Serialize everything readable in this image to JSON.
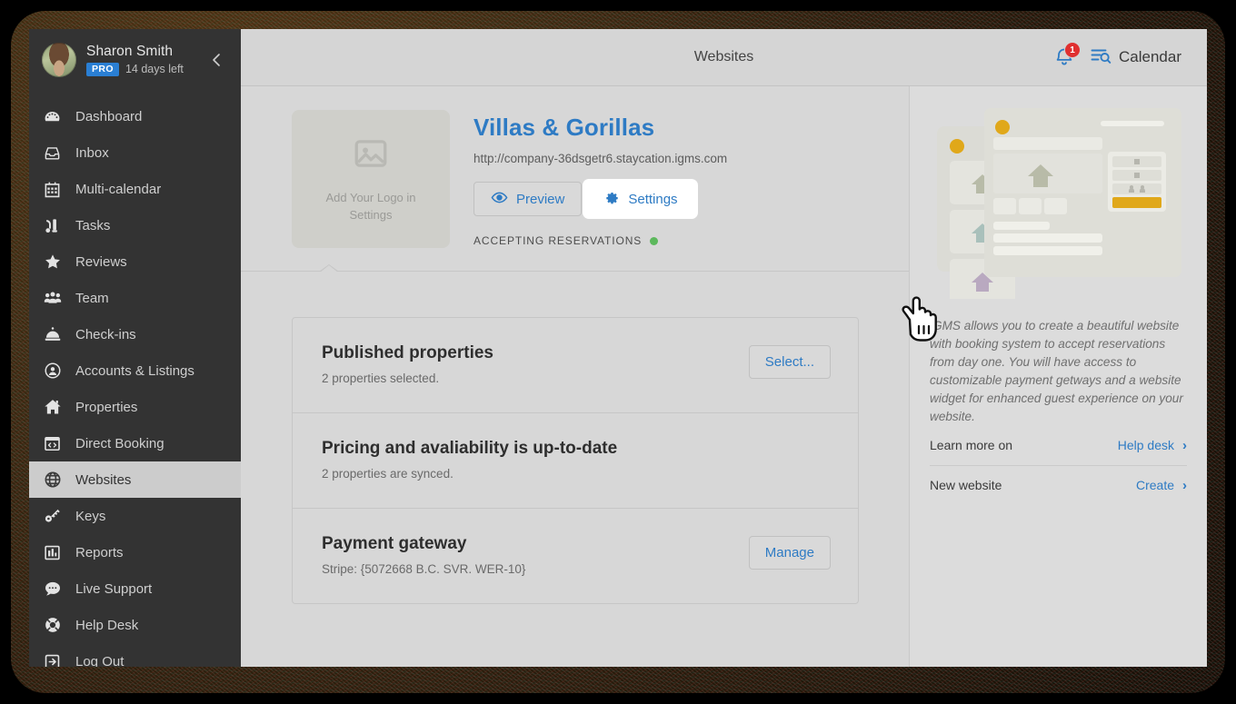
{
  "sidebar": {
    "user": {
      "name": "Sharon Smith",
      "badge": "PRO",
      "trial": "14 days left",
      "avatar_icon": "user-avatar-photo",
      "collapse_icon": "chevron-left-icon"
    },
    "items": [
      {
        "label": "Dashboard",
        "icon": "gauge-icon",
        "active": false
      },
      {
        "label": "Inbox",
        "icon": "inbox-icon",
        "active": false
      },
      {
        "label": "Multi-calendar",
        "icon": "calendar-icon",
        "active": false
      },
      {
        "label": "Tasks",
        "icon": "vacuum-icon",
        "active": false
      },
      {
        "label": "Reviews",
        "icon": "star-icon",
        "active": false
      },
      {
        "label": "Team",
        "icon": "users-icon",
        "active": false
      },
      {
        "label": "Check-ins",
        "icon": "bell-desk-icon",
        "active": false
      },
      {
        "label": "Accounts & Listings",
        "icon": "user-circle-icon",
        "active": false
      },
      {
        "label": "Properties",
        "icon": "home-icon",
        "active": false
      },
      {
        "label": "Direct Booking",
        "icon": "code-window-icon",
        "active": false
      },
      {
        "label": "Websites",
        "icon": "globe-icon",
        "active": true
      },
      {
        "label": "Keys",
        "icon": "key-icon",
        "active": false
      },
      {
        "label": "Reports",
        "icon": "bar-chart-icon",
        "active": false
      },
      {
        "label": "Live Support",
        "icon": "chat-bubble-icon",
        "active": false
      },
      {
        "label": "Help Desk",
        "icon": "lifebuoy-icon",
        "active": false
      },
      {
        "label": "Log Out",
        "icon": "logout-icon",
        "active": false
      }
    ]
  },
  "topbar": {
    "title": "Websites",
    "notifications_count": "1",
    "bell_icon": "notification-bell-icon",
    "calendar_label": "Calendar",
    "calendar_icon": "calendar-search-icon"
  },
  "site": {
    "logo_placeholder_line1": "Add Your Logo in",
    "logo_placeholder_line2": "Settings",
    "logo_icon": "image-placeholder-icon",
    "name": "Villas & Gorillas",
    "url": "http://company-36dsgetr6.staycation.igms.com",
    "preview_label": "Preview",
    "preview_icon": "eye-icon",
    "settings_label": "Settings",
    "settings_icon": "gear-icon",
    "status_label": "ACCEPTING RESERVATIONS",
    "status_color": "#5cb85c"
  },
  "cards": [
    {
      "title": "Published properties",
      "subtitle": "2 properties selected.",
      "action": "Select..."
    },
    {
      "title": "Pricing and avaliability is up-to-date",
      "subtitle": "2 properties are synced.",
      "action": ""
    },
    {
      "title": "Payment gateway",
      "subtitle": "Stripe: {5072668 B.C. SVR. WER-10}",
      "action": "Manage"
    }
  ],
  "rightpanel": {
    "illustration_icon": "website-builder-illustration",
    "description": "iGMS allows you to create a beautiful website with booking system to accept reservations from day one. You will have access to customizable payment getways and a website widget for enhanced guest experience on your website.",
    "rows": [
      {
        "label": "Learn more on",
        "link": "Help desk",
        "chevron": "›"
      },
      {
        "label": "New website",
        "link": "Create",
        "chevron": "›"
      }
    ]
  },
  "cursor": {
    "icon": "pointing-hand-cursor"
  },
  "colors": {
    "accent": "#2e7bc4",
    "sidebar_bg": "#333333",
    "content_bg": "#d7d7d7",
    "status_green": "#5cb85c",
    "badge_red": "#e03030",
    "pro_blue": "#2a7fd4",
    "illustration_yellow": "#e0a81a"
  }
}
